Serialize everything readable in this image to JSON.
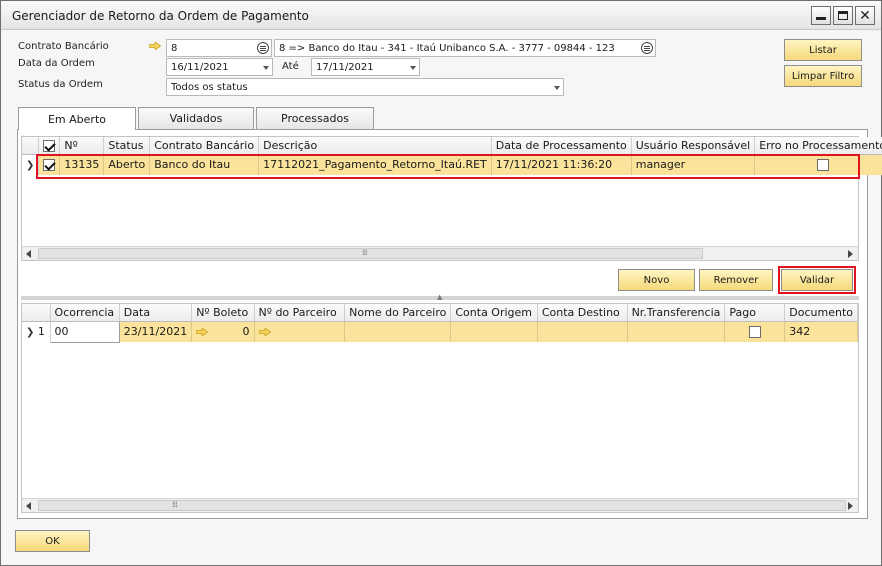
{
  "window": {
    "title": "Gerenciador de Retorno da Ordem de Pagamento"
  },
  "form": {
    "contrato_label": "Contrato Bancário",
    "contrato_value": "8",
    "contrato_desc": "8 => Banco do Itau - 341 - Itaú Unibanco  S.A. - 3777 - 09844 - 123",
    "data_label": "Data da Ordem",
    "data_from": "16/11/2021",
    "ate_label": "Até",
    "data_to": "17/11/2021",
    "status_label": "Status da Ordem",
    "status_value": "Todos os status"
  },
  "buttons": {
    "listar": "Listar",
    "limpar": "Limpar Filtro",
    "novo": "Novo",
    "remover": "Remover",
    "validar": "Validar",
    "ok": "OK"
  },
  "tabs": [
    "Em Aberto",
    "Validados",
    "Processados"
  ],
  "grid1": {
    "columns": [
      "Nº",
      "Status",
      "Contrato Bancário",
      "Descrição",
      "Data de Processamento",
      "Usuário Responsável",
      "Erro no Processamento"
    ],
    "rows": [
      {
        "selected": true,
        "num": "13135",
        "status": "Aberto",
        "contrato": "Banco do Itau",
        "descricao": "17112021_Pagamento_Retorno_Itaú.RET",
        "data": "17/11/2021 11:36:20",
        "usuario": "manager",
        "erro": false
      }
    ]
  },
  "grid2": {
    "columns": [
      "Ocorrencia",
      "Data",
      "Nº Boleto",
      "Nº do Parceiro",
      "Nome do Parceiro",
      "Conta Origem",
      "Conta Destino",
      "Nr.Transferencia",
      "Pago",
      "Documento"
    ],
    "rows": [
      {
        "index": "1",
        "ocorrencia": "00",
        "data": "23/11/2021",
        "boleto": "0",
        "parceiro": "",
        "nome": "",
        "origem": "",
        "destino": "",
        "transferencia": "",
        "pago": false,
        "documento": "342"
      }
    ]
  },
  "colors": {
    "row_highlight": "#fbe39c",
    "button": "#f5d97a",
    "highlight_border": "#e0141e"
  }
}
